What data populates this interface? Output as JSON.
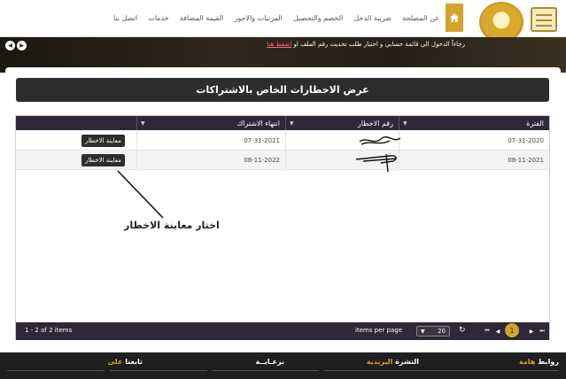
{
  "nav": {
    "items": [
      "عن المصلحة",
      "ضريبة الدخل",
      "الخصم والتحصيل",
      "المرتبات والاجور",
      "القيمة المضافة",
      "خدمات",
      "اتصل بنا"
    ]
  },
  "hero": {
    "ticker_text": "رجاءاً الدخول الى قائمة حسابي و اختيار طلب تحديث رقم الملف او",
    "ticker_link": "اضغط هنا"
  },
  "page": {
    "title": "عرض الاخطارات الخاص بالاشتراكات"
  },
  "grid": {
    "columns": [
      "الفترة",
      "رقم الاخطار",
      "انتهاء الاشتراك"
    ],
    "rows": [
      {
        "period": "07-31-2020",
        "notice_no": "",
        "expiry": "07-31-2021",
        "action": "معاينة الاخطار"
      },
      {
        "period": "08-11-2021",
        "notice_no": "",
        "expiry": "08-11-2022",
        "action": "معاينة الاخطار"
      }
    ]
  },
  "annotation": "اختار معاينة الاخطار",
  "pager": {
    "current_page": "1",
    "items_per_page_label": "items per page",
    "items_per_page": "20",
    "info": "1 - 2 of 2 items"
  },
  "footer": {
    "links_a": "روابط",
    "links_b": "هامة",
    "news_a": "النشرة",
    "news_b": "البريدية",
    "sponsor": "برعـايــة",
    "follow_a": "تابعنا",
    "follow_b": "على"
  },
  "colors": {
    "accent": "#d4a32a",
    "header_dark": "#2e2838",
    "button_dark": "#2d2d2d"
  }
}
